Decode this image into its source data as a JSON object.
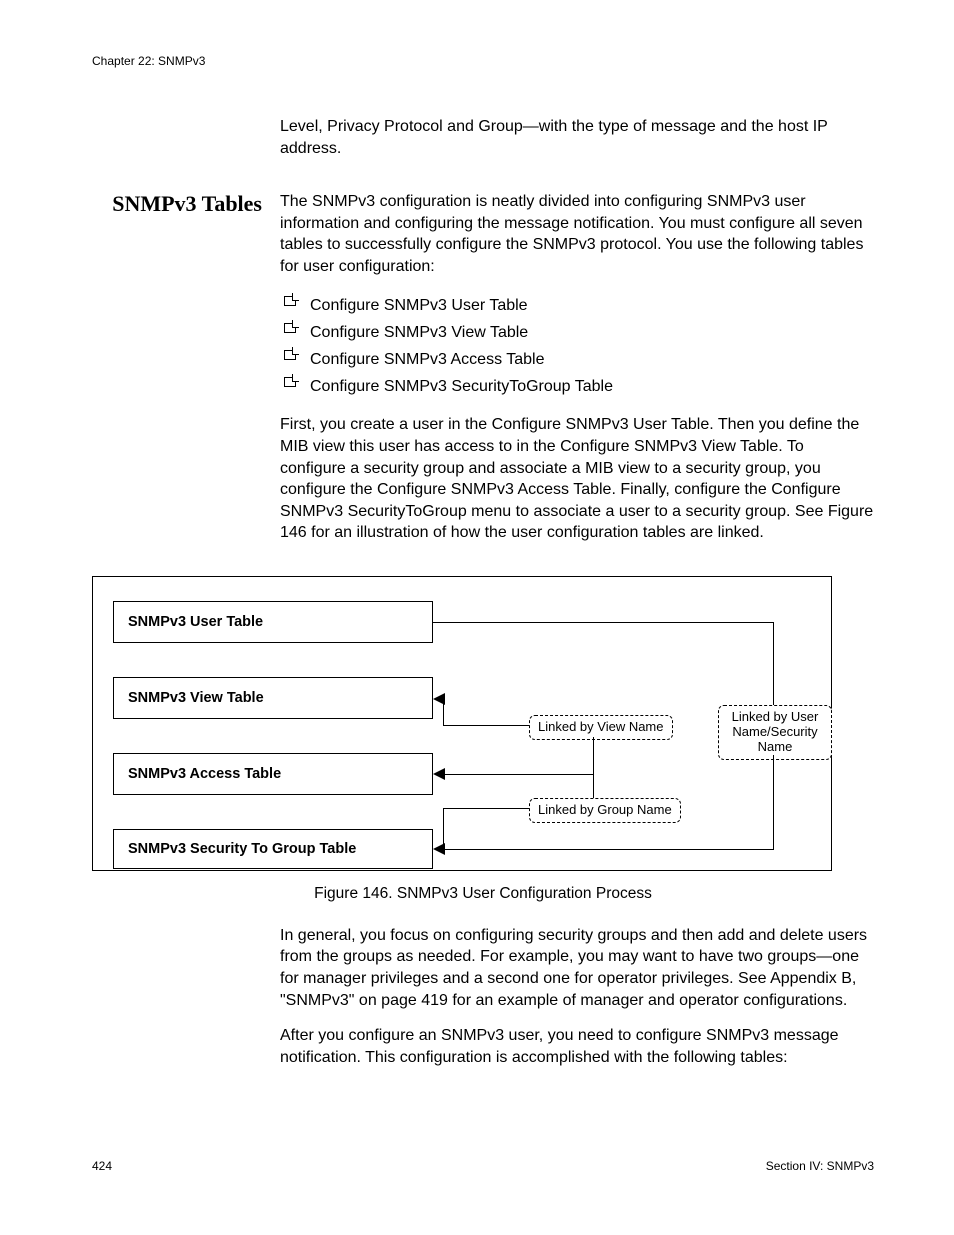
{
  "header": {
    "chapter": "Chapter 22: SNMPv3"
  },
  "intro_continuation": "Level, Privacy Protocol and Group—with the type of message and the host IP address.",
  "section": {
    "title": "SNMPv3 Tables",
    "p1": "The SNMPv3 configuration is neatly divided into configuring SNMPv3 user information and configuring the message notification. You must configure all seven tables to successfully configure the SNMPv3 protocol. You use the following tables for user configuration:",
    "bullets": [
      "Configure SNMPv3 User Table",
      "Configure SNMPv3 View Table",
      "Configure SNMPv3 Access Table",
      "Configure SNMPv3 SecurityToGroup Table"
    ],
    "p2": "First, you create a user in the Configure SNMPv3 User Table. Then you define the MIB view this user has access to in the Configure SNMPv3 View Table. To configure a security group and associate a MIB view to a security group, you configure the Configure SNMPv3 Access Table. Finally, configure the Configure SNMPv3 SecurityToGroup menu to associate a user to a security group. See Figure 146 for an illustration of how the user configuration tables are linked."
  },
  "figure": {
    "tables": {
      "user": "SNMPv3 User Table",
      "view": "SNMPv3 View Table",
      "access": "SNMPv3 Access Table",
      "security": "SNMPv3 Security To Group Table"
    },
    "labels": {
      "view": "Linked by View Name",
      "group": "Linked by Group Name",
      "user": "Linked by User Name/Security Name"
    },
    "caption": "Figure 146. SNMPv3 User Configuration Process"
  },
  "after": {
    "p3": "In general, you focus on configuring security groups and then add and delete users from the groups as needed. For example, you may want to have two groups—one for manager privileges and a second one for operator privileges. See Appendix B, \"SNMPv3\" on page 419 for an example of manager and operator configurations.",
    "p4": "After you configure an SNMPv3 user, you need to configure SNMPv3 message notification. This configuration is accomplished with the following tables:"
  },
  "footer": {
    "page": "424",
    "section": "Section IV: SNMPv3"
  }
}
